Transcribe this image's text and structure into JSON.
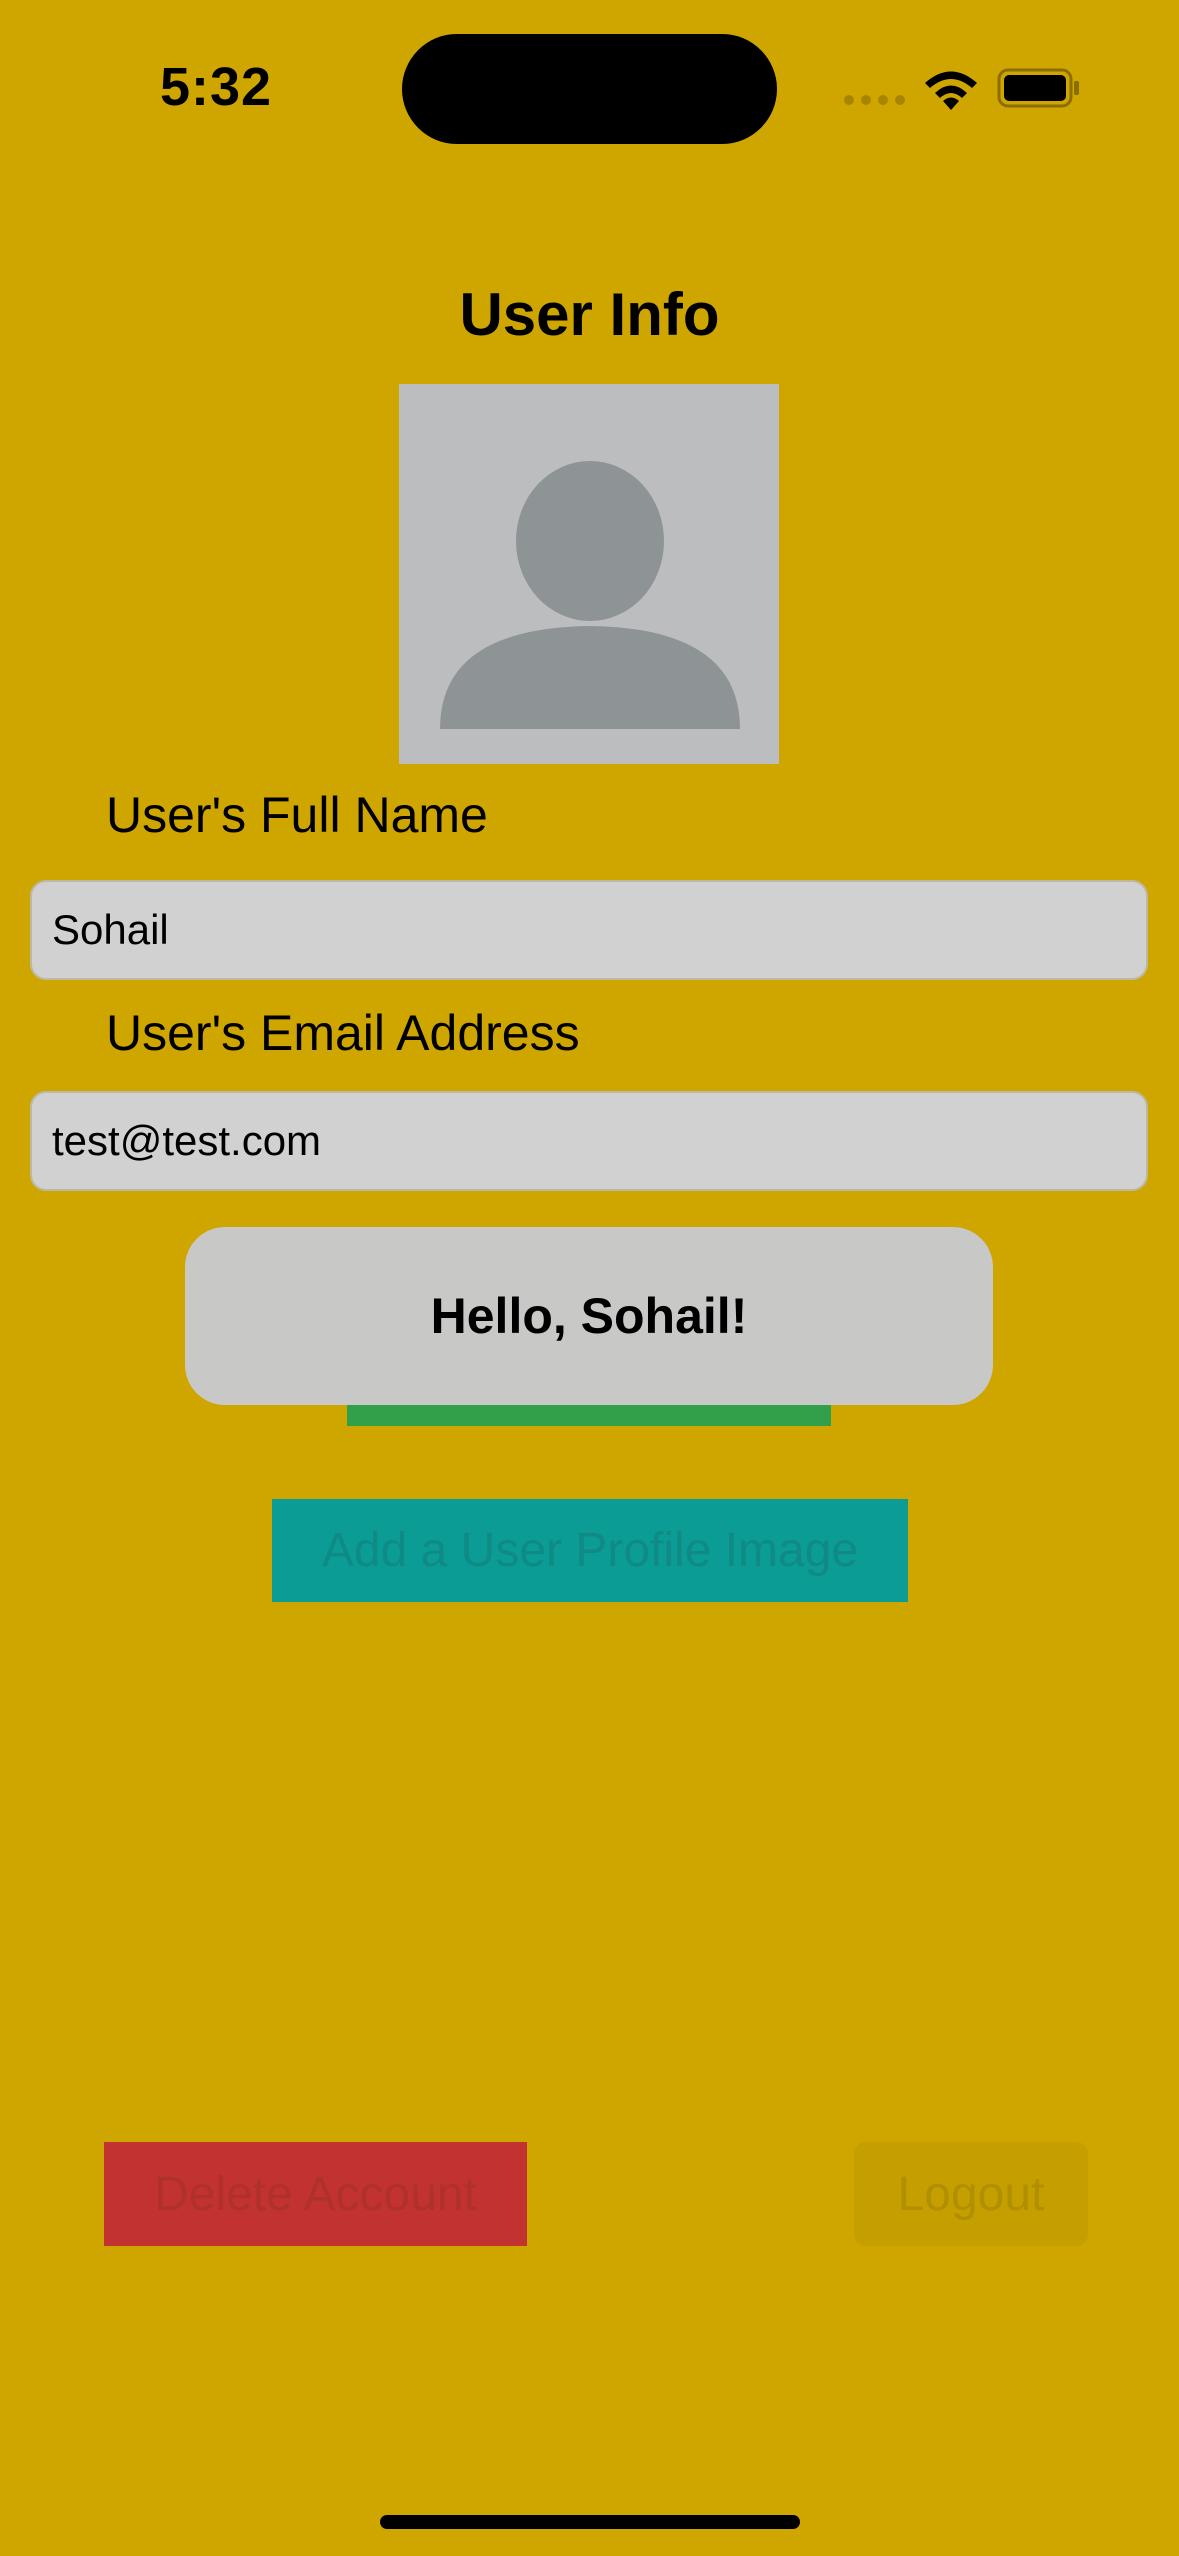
{
  "status_bar": {
    "time": "5:32"
  },
  "page": {
    "title": "User Info"
  },
  "form": {
    "name_label": "User's Full Name",
    "name_value": "Sohail",
    "email_label": "User's Email Address",
    "email_value": "test@test.com"
  },
  "toast": {
    "message": "Hello, Sohail!"
  },
  "buttons": {
    "add_image_label": "Add a User Profile Image",
    "delete_label": "Delete Account",
    "logout_label": "Logout"
  },
  "icons": {
    "avatar": "person-silhouette-icon",
    "signal": "cellular-signal-icon",
    "wifi": "wifi-icon",
    "battery": "battery-icon"
  },
  "colors": {
    "background": "#CFA500",
    "toast_background": "#C8C8C6",
    "add_image_button": "#0C9C96",
    "delete_button": "#C13230",
    "update_button": "#32A04A"
  }
}
